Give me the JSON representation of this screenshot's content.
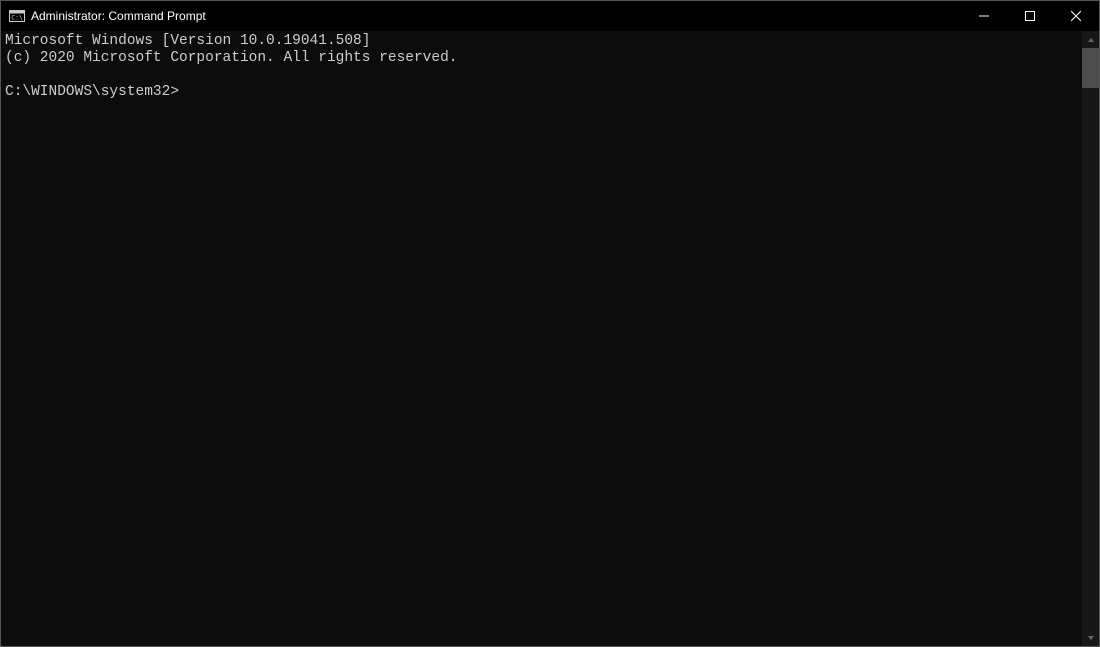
{
  "titlebar": {
    "title": "Administrator: Command Prompt"
  },
  "terminal": {
    "line1": "Microsoft Windows [Version 10.0.19041.508]",
    "line2": "(c) 2020 Microsoft Corporation. All rights reserved.",
    "blank": "",
    "prompt": "C:\\WINDOWS\\system32>"
  }
}
